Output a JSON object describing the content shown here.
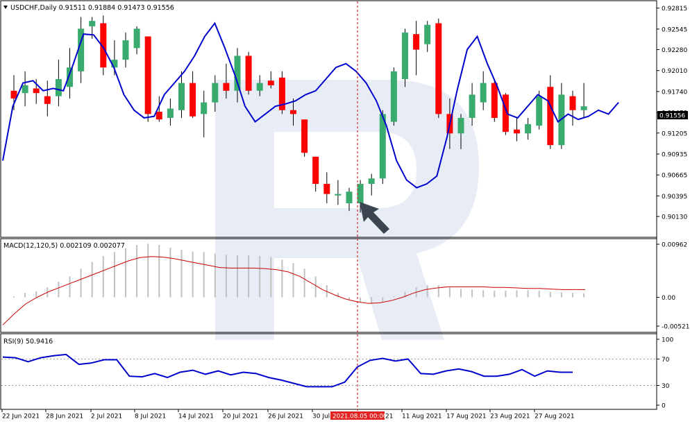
{
  "main_panel": {
    "title": "USDCHF,Daily  0.91511 0.91884 0.91473 0.91556",
    "price_ticks": [
      "0.92815",
      "0.92545",
      "0.92280",
      "0.92010",
      "0.91740",
      "0.91470",
      "0.91205",
      "0.90935",
      "0.90665",
      "0.90395",
      "0.90130"
    ],
    "current_price_label": "0.91556"
  },
  "macd_panel": {
    "title": "MACD(12,120,5) 0.002109 0.002077",
    "ticks": [
      "0.00962",
      "0.00",
      "-0.005212"
    ]
  },
  "rsi_panel": {
    "title": "RSI(9) 50.9416",
    "ticks": [
      "100",
      "70",
      "30",
      "0"
    ]
  },
  "x_axis": {
    "labels": [
      "22 Jun 2021",
      "28 Jun 2021",
      "2 Jul 2021",
      "8 Jul 2021",
      "14 Jul 2021",
      "20 Jul 2021",
      "26 Jul 2021",
      "30 Jul",
      "11 Aug 2021",
      "17 Aug 2021",
      "23 Aug 2021",
      "27 Aug 2021"
    ],
    "label_trailing": "21",
    "crosshair_label": "2021.08.05 00:00"
  },
  "colors": {
    "bull": "#3aab6e",
    "bear": "#ff0000",
    "ma_line": "#0000cc",
    "macd_signal": "#cc0000",
    "macd_hist": "#c0c0c0",
    "rsi_line": "#0000cc",
    "crosshair": "#cc0000",
    "watermark": "#e6ebf3"
  },
  "chart_data": [
    {
      "type": "candlestick",
      "symbol": "USDCHF",
      "timeframe": "Daily",
      "ylim": [
        0.9013,
        0.9283
      ],
      "candles": [
        {
          "o": 0.9175,
          "h": 0.9195,
          "l": 0.915,
          "c": 0.9165
        },
        {
          "o": 0.9172,
          "h": 0.92,
          "l": 0.9155,
          "c": 0.9182
        },
        {
          "o": 0.9178,
          "h": 0.919,
          "l": 0.9158,
          "c": 0.9172
        },
        {
          "o": 0.9168,
          "h": 0.9188,
          "l": 0.9142,
          "c": 0.9158
        },
        {
          "o": 0.9168,
          "h": 0.9215,
          "l": 0.9155,
          "c": 0.919
        },
        {
          "o": 0.918,
          "h": 0.923,
          "l": 0.9165,
          "c": 0.9205
        },
        {
          "o": 0.92,
          "h": 0.927,
          "l": 0.9185,
          "c": 0.9255
        },
        {
          "o": 0.9258,
          "h": 0.927,
          "l": 0.9242,
          "c": 0.9265
        },
        {
          "o": 0.9262,
          "h": 0.9272,
          "l": 0.9195,
          "c": 0.9205
        },
        {
          "o": 0.9205,
          "h": 0.924,
          "l": 0.9195,
          "c": 0.9215
        },
        {
          "o": 0.9215,
          "h": 0.925,
          "l": 0.9205,
          "c": 0.924
        },
        {
          "o": 0.923,
          "h": 0.9258,
          "l": 0.9222,
          "c": 0.9255
        },
        {
          "o": 0.9245,
          "h": 0.9245,
          "l": 0.9135,
          "c": 0.9145
        },
        {
          "o": 0.9148,
          "h": 0.9168,
          "l": 0.9135,
          "c": 0.9138
        },
        {
          "o": 0.914,
          "h": 0.9165,
          "l": 0.913,
          "c": 0.9152
        },
        {
          "o": 0.915,
          "h": 0.92,
          "l": 0.914,
          "c": 0.9185
        },
        {
          "o": 0.9185,
          "h": 0.92,
          "l": 0.914,
          "c": 0.9142
        },
        {
          "o": 0.9145,
          "h": 0.9175,
          "l": 0.9115,
          "c": 0.916
        },
        {
          "o": 0.916,
          "h": 0.9195,
          "l": 0.9148,
          "c": 0.9185
        },
        {
          "o": 0.9185,
          "h": 0.921,
          "l": 0.9165,
          "c": 0.9175
        },
        {
          "o": 0.9175,
          "h": 0.923,
          "l": 0.916,
          "c": 0.922
        },
        {
          "o": 0.922,
          "h": 0.9225,
          "l": 0.917,
          "c": 0.9175
        },
        {
          "o": 0.9175,
          "h": 0.9195,
          "l": 0.9168,
          "c": 0.9185
        },
        {
          "o": 0.9188,
          "h": 0.92,
          "l": 0.9178,
          "c": 0.9182
        },
        {
          "o": 0.9192,
          "h": 0.92,
          "l": 0.9145,
          "c": 0.915
        },
        {
          "o": 0.915,
          "h": 0.9165,
          "l": 0.913,
          "c": 0.9145
        },
        {
          "o": 0.9138,
          "h": 0.9138,
          "l": 0.909,
          "c": 0.9095
        },
        {
          "o": 0.909,
          "h": 0.909,
          "l": 0.9045,
          "c": 0.9055
        },
        {
          "o": 0.9055,
          "h": 0.907,
          "l": 0.903,
          "c": 0.9042
        },
        {
          "o": 0.904,
          "h": 0.906,
          "l": 0.9028,
          "c": 0.9042
        },
        {
          "o": 0.903,
          "h": 0.905,
          "l": 0.902,
          "c": 0.9045
        },
        {
          "o": 0.903,
          "h": 0.906,
          "l": 0.9018,
          "c": 0.9055
        },
        {
          "o": 0.9055,
          "h": 0.9068,
          "l": 0.904,
          "c": 0.9062
        },
        {
          "o": 0.9062,
          "h": 0.915,
          "l": 0.9055,
          "c": 0.9145
        },
        {
          "o": 0.9135,
          "h": 0.9205,
          "l": 0.913,
          "c": 0.92
        },
        {
          "o": 0.919,
          "h": 0.9255,
          "l": 0.918,
          "c": 0.925
        },
        {
          "o": 0.9248,
          "h": 0.9265,
          "l": 0.9195,
          "c": 0.9228
        },
        {
          "o": 0.9235,
          "h": 0.9265,
          "l": 0.9225,
          "c": 0.926
        },
        {
          "o": 0.9262,
          "h": 0.9268,
          "l": 0.914,
          "c": 0.9145
        },
        {
          "o": 0.9145,
          "h": 0.9165,
          "l": 0.91,
          "c": 0.912
        },
        {
          "o": 0.912,
          "h": 0.9145,
          "l": 0.91,
          "c": 0.914
        },
        {
          "o": 0.914,
          "h": 0.9185,
          "l": 0.913,
          "c": 0.917
        },
        {
          "o": 0.916,
          "h": 0.92,
          "l": 0.915,
          "c": 0.9185
        },
        {
          "o": 0.9185,
          "h": 0.919,
          "l": 0.9135,
          "c": 0.914
        },
        {
          "o": 0.917,
          "h": 0.9172,
          "l": 0.9118,
          "c": 0.9122
        },
        {
          "o": 0.9125,
          "h": 0.914,
          "l": 0.911,
          "c": 0.912
        },
        {
          "o": 0.912,
          "h": 0.914,
          "l": 0.9112,
          "c": 0.9132
        },
        {
          "o": 0.913,
          "h": 0.9175,
          "l": 0.9125,
          "c": 0.9168
        },
        {
          "o": 0.918,
          "h": 0.9195,
          "l": 0.91,
          "c": 0.9105
        },
        {
          "o": 0.9105,
          "h": 0.9185,
          "l": 0.91,
          "c": 0.917
        },
        {
          "o": 0.9168,
          "h": 0.9175,
          "l": 0.913,
          "c": 0.915
        },
        {
          "o": 0.915,
          "h": 0.9185,
          "l": 0.914,
          "c": 0.9155
        }
      ],
      "ma_line": [
        0.9085,
        0.9155,
        0.9185,
        0.9188,
        0.9175,
        0.9178,
        0.9175,
        0.921,
        0.9248,
        0.9247,
        0.923,
        0.9205,
        0.917,
        0.915,
        0.914,
        0.9142,
        0.917,
        0.9185,
        0.92,
        0.922,
        0.9245,
        0.9262,
        0.923,
        0.9195,
        0.9155,
        0.9135,
        0.9145,
        0.9155,
        0.9158,
        0.9162,
        0.917,
        0.9175,
        0.919,
        0.9205,
        0.921,
        0.92,
        0.9185,
        0.9162,
        0.913,
        0.9085,
        0.906,
        0.905,
        0.9055,
        0.9065,
        0.9115,
        0.9175,
        0.9228,
        0.9245,
        0.921,
        0.918,
        0.9145,
        0.914,
        0.9155,
        0.917,
        0.9162,
        0.9135,
        0.9145,
        0.9138,
        0.9142,
        0.915,
        0.9145,
        0.916
      ]
    },
    {
      "type": "bar+line",
      "name": "MACD(12,120,5)",
      "ylim": [
        -0.005212,
        0.00962
      ],
      "histogram": [
        0.0002,
        0.0008,
        0.0011,
        0.0018,
        0.0028,
        0.0038,
        0.0052,
        0.0064,
        0.0075,
        0.0082,
        0.0089,
        0.0095,
        0.0097,
        0.0095,
        0.009,
        0.0086,
        0.0083,
        0.0082,
        0.0079,
        0.0077,
        0.0076,
        0.0076,
        0.0075,
        0.0073,
        0.0068,
        0.0062,
        0.0052,
        0.0038,
        0.0022,
        0.0008,
        -0.0004,
        -0.0008,
        -0.0012,
        -0.0008,
        0.0002,
        0.001,
        0.0018,
        0.0022,
        0.0022,
        0.0018,
        0.0015,
        0.0014,
        0.0013,
        0.0012,
        0.0012,
        0.0013,
        0.0013,
        0.0012,
        0.001,
        0.0009,
        0.0008,
        0.0007
      ],
      "signal": [
        -0.005,
        -0.003,
        -0.0012,
        0.0,
        0.001,
        0.0018,
        0.0026,
        0.0034,
        0.0042,
        0.005,
        0.0058,
        0.0066,
        0.0072,
        0.0074,
        0.0073,
        0.007,
        0.0066,
        0.0062,
        0.0058,
        0.0054,
        0.0053,
        0.0053,
        0.0053,
        0.0052,
        0.005,
        0.0046,
        0.0038,
        0.0026,
        0.0014,
        0.0005,
        -0.0003,
        -0.0008,
        -0.0011,
        -0.001,
        -0.0006,
        0.0,
        0.0008,
        0.0014,
        0.0017,
        0.0019,
        0.0019,
        0.0019,
        0.0019,
        0.0018,
        0.0018,
        0.0017,
        0.0016,
        0.0016,
        0.0015,
        0.0014,
        0.0014,
        0.0014
      ]
    },
    {
      "type": "line",
      "name": "RSI(9)",
      "ylim": [
        0,
        100
      ],
      "levels": [
        70,
        30
      ],
      "values": [
        73,
        72,
        66,
        72,
        75,
        77,
        62,
        64,
        69,
        69,
        44,
        43,
        48,
        42,
        50,
        53,
        47,
        52,
        46,
        50,
        48,
        42,
        38,
        33,
        28,
        28,
        28,
        35,
        58,
        68,
        71,
        67,
        70,
        48,
        47,
        52,
        55,
        51,
        44,
        44,
        47,
        54,
        44,
        52,
        50,
        50
      ]
    }
  ]
}
